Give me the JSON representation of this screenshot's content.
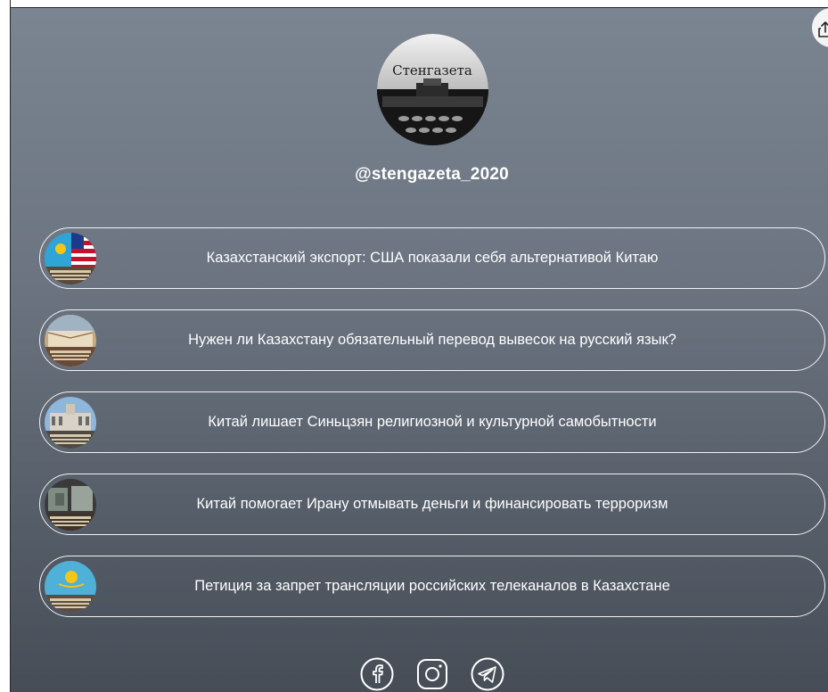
{
  "profile": {
    "avatar_text": "Стенгазета",
    "handle": "@stengazeta_2020"
  },
  "links": [
    {
      "label": "Казахстанский экспорт: США показали себя альтернативой Китаю",
      "thumb": "kz-usa-flags"
    },
    {
      "label": "Нужен ли Казахстану обязательный перевод вывесок на русский язык?",
      "thumb": "books-qazaq"
    },
    {
      "label": "Китай лишает Синьцзян религиозной и культурной самобытности",
      "thumb": "mosque-building"
    },
    {
      "label": "Китай помогает Ирану отмывать деньги и финансировать терроризм",
      "thumb": "money-stacks"
    },
    {
      "label": "Петиция за запрет трансляции российских телеканалов в Казахстане",
      "thumb": "kz-flag"
    }
  ],
  "socials": [
    {
      "icon": "facebook-icon"
    },
    {
      "icon": "instagram-icon"
    },
    {
      "icon": "telegram-icon"
    }
  ],
  "colors": {
    "bg_top": "#7b8592",
    "bg_bottom": "#464d57",
    "text": "#ffffff"
  }
}
